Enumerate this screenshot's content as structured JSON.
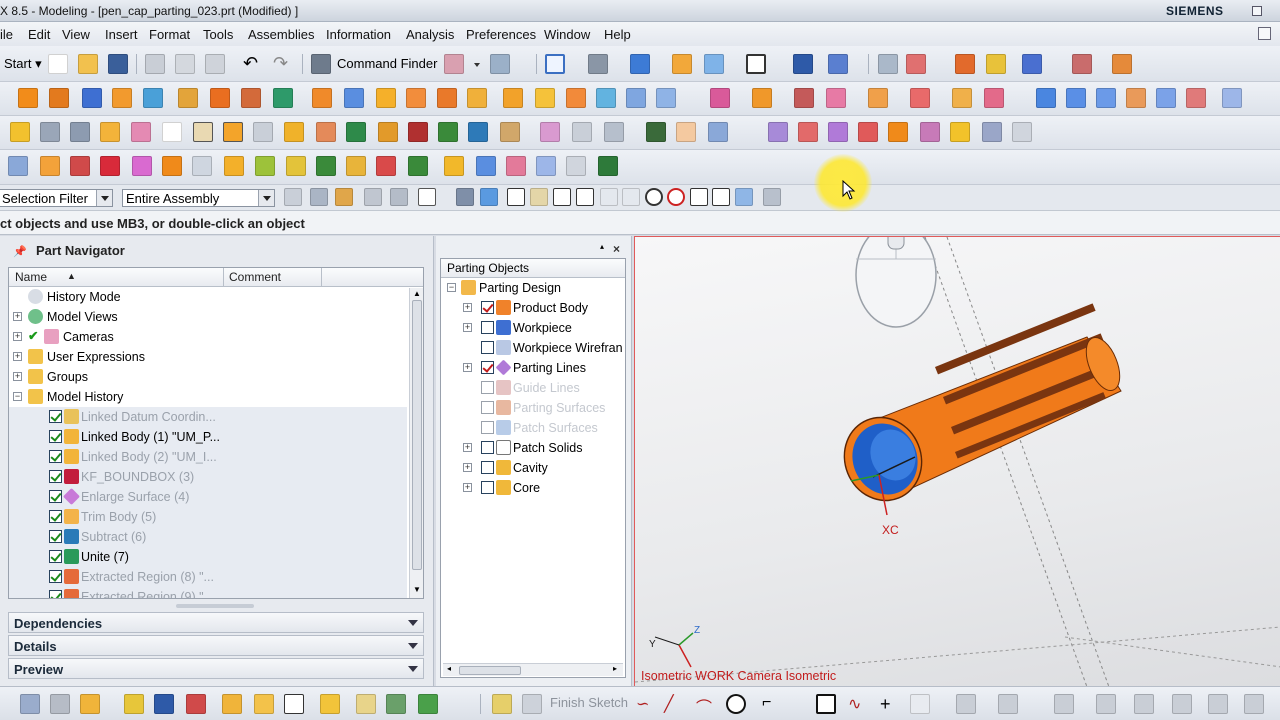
{
  "window": {
    "title": "X 8.5 - Modeling - [pen_cap_parting_023.prt (Modified) ]",
    "brand": "SIEMENS"
  },
  "menu": [
    "ile",
    "Edit",
    "View",
    "Insert",
    "Format",
    "Tools",
    "Assemblies",
    "Information",
    "Analysis",
    "Preferences",
    "Window",
    "Help"
  ],
  "toolbar": {
    "start_label": "Start",
    "command_finder_label": "Command Finder"
  },
  "filters": {
    "selection_filter": "Selection Filter",
    "scope": "Entire Assembly"
  },
  "cue_line": "ct objects and use MB3, or double-click an object",
  "part_navigator": {
    "title": "Part Navigator",
    "columns": [
      "Name",
      "Comment"
    ],
    "rows": [
      {
        "label": "History Mode",
        "dim": false,
        "checked": null
      },
      {
        "label": "Model Views",
        "dim": false,
        "checked": null
      },
      {
        "label": "Cameras",
        "dim": false,
        "checked": null
      },
      {
        "label": "User Expressions",
        "dim": false,
        "checked": null
      },
      {
        "label": "Groups",
        "dim": false,
        "checked": null
      },
      {
        "label": "Model History",
        "dim": false,
        "checked": null
      },
      {
        "label": "Linked Datum Coordin...",
        "dim": true,
        "checked": true
      },
      {
        "label": "Linked Body (1) \"UM_P...",
        "dim": false,
        "checked": true
      },
      {
        "label": "Linked Body (2) \"UM_I...",
        "dim": true,
        "checked": true
      },
      {
        "label": "KF_BOUNDBOX (3)",
        "dim": true,
        "checked": true
      },
      {
        "label": "Enlarge Surface (4)",
        "dim": true,
        "checked": true
      },
      {
        "label": "Trim Body (5)",
        "dim": true,
        "checked": true
      },
      {
        "label": "Subtract (6)",
        "dim": true,
        "checked": true
      },
      {
        "label": "Unite (7)",
        "dim": false,
        "checked": true
      },
      {
        "label": "Extracted Region (8) \"...",
        "dim": true,
        "checked": true
      },
      {
        "label": "Extracted Region (9) \"...",
        "dim": true,
        "checked": true
      }
    ],
    "sections": [
      "Dependencies",
      "Details",
      "Preview"
    ]
  },
  "parting_navigator": {
    "column": "Parting Objects",
    "rows": [
      {
        "label": "Parting Design",
        "dim": false,
        "checked": null
      },
      {
        "label": "Product Body",
        "dim": false,
        "checked": true
      },
      {
        "label": "Workpiece",
        "dim": false,
        "checked": false
      },
      {
        "label": "Workpiece Wirefran",
        "dim": false,
        "checked": false
      },
      {
        "label": "Parting Lines",
        "dim": false,
        "checked": true
      },
      {
        "label": "Guide Lines",
        "dim": true,
        "checked": false
      },
      {
        "label": "Parting Surfaces",
        "dim": true,
        "checked": false
      },
      {
        "label": "Patch Surfaces",
        "dim": true,
        "checked": false
      },
      {
        "label": "Patch Solids",
        "dim": false,
        "checked": false
      },
      {
        "label": "Cavity",
        "dim": false,
        "checked": false
      },
      {
        "label": "Core",
        "dim": false,
        "checked": false
      }
    ]
  },
  "viewport": {
    "caption": "Isometric WORK Camera Isometric",
    "axis_label": "XC",
    "triad_labels": [
      "Y",
      "Z"
    ]
  },
  "bottom_toolbar": {
    "finish_sketch_label": "Finish Sketch"
  },
  "colors": {
    "accent_orange": "#f07a1a",
    "inner_blue": "#2f6fd0",
    "check_green": "#1a8a1a",
    "check_red": "#c21c1c",
    "cursor_highlight": "#ffe83a"
  }
}
